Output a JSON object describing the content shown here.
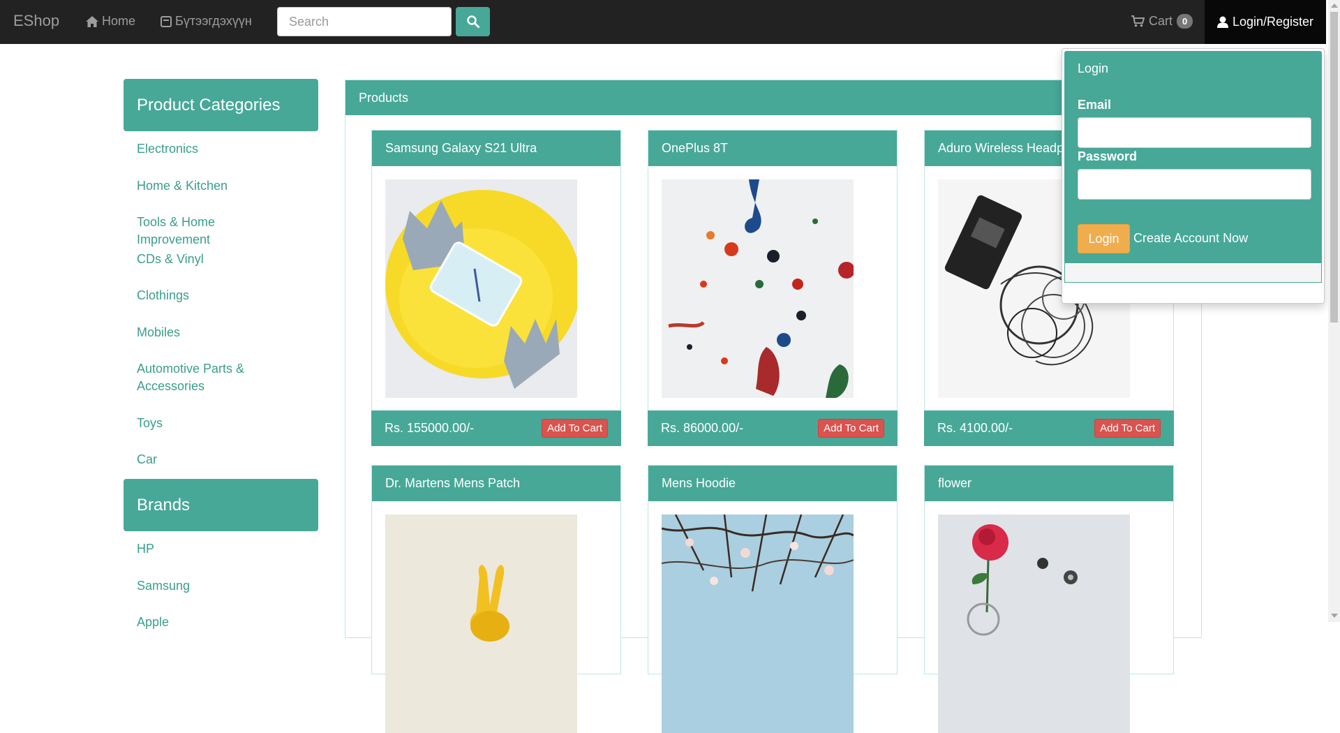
{
  "navbar": {
    "brand": "EShop",
    "home_label": "Home",
    "products_label": "Бүтээгдэхүүн",
    "search_placeholder": "Search",
    "cart_label": "Cart",
    "cart_count": "0",
    "login_label": "Login/Register"
  },
  "sidebar": {
    "categories_title": "Product Categories",
    "categories": [
      "Electronics",
      "Home & Kitchen",
      "Tools & Home Improvement",
      "CDs & Vinyl",
      "Clothings",
      "Mobiles",
      "Automotive Parts & Accessories",
      "Toys",
      "Car"
    ],
    "brands_title": "Brands",
    "brands": [
      "HP",
      "Samsung",
      "Apple"
    ]
  },
  "products": {
    "title": "Products",
    "add_to_cart_label": "Add To Cart",
    "items": [
      {
        "name": "Samsung Galaxy S21 Ultra",
        "price": "Rs. 155000.00/-"
      },
      {
        "name": "OnePlus 8T",
        "price": "Rs. 86000.00/-"
      },
      {
        "name": "Aduro Wireless Headphones",
        "price": "Rs. 4100.00/-"
      },
      {
        "name": "Dr. Martens Mens Patch",
        "price": ""
      },
      {
        "name": "Mens Hoodie",
        "price": ""
      },
      {
        "name": "flower",
        "price": ""
      }
    ]
  },
  "login_dropdown": {
    "title": "Login",
    "email_label": "Email",
    "password_label": "Password",
    "login_button": "Login",
    "create_account": "Create Account Now"
  },
  "colors": {
    "navbar_bg": "#222222",
    "primary": "#47a898",
    "link": "#3a9e8b",
    "danger": "#d9534f",
    "warning": "#f0ad4e"
  },
  "icons": [
    "home-icon",
    "product-icon",
    "search-icon",
    "cart-icon",
    "user-icon"
  ]
}
